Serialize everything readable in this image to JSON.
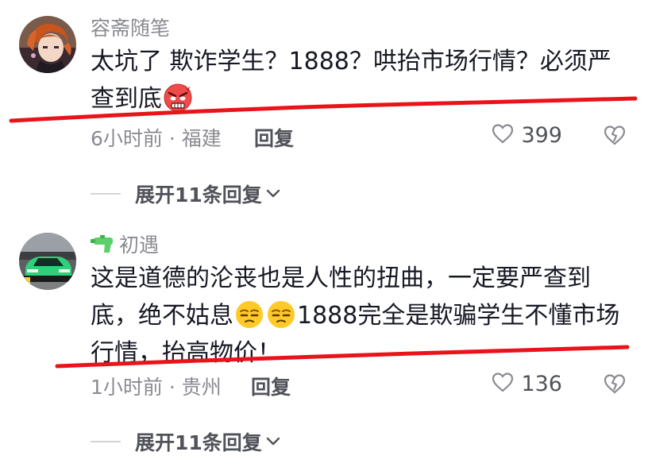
{
  "comments": [
    {
      "username": "容斋随笔",
      "content": [
        "太坑了 欺诈学生？1888？哄抬市场行情？必须严",
        "查到底"
      ],
      "time_location": "6小时前 · 福建",
      "reply_label": "回复",
      "like_count": "399",
      "expand_label": "展开11条回复",
      "emoji": "angry-face-icon",
      "avatar": "avatar-anime-character"
    },
    {
      "username": "初遇",
      "username_icon": "water-gun-icon",
      "content": [
        "这是道德的沦丧也是人性的扭曲，一定要严查到",
        "底，绝不姑息",
        "1888完全是欺骗学生不懂市场",
        "行情，抬高物价！"
      ],
      "time_location": "1小时前 · 贵州",
      "reply_label": "回复",
      "like_count": "136",
      "expand_label": "展开11条回复",
      "emoji": "unamused-face-icon",
      "avatar": "avatar-green-car"
    }
  ],
  "colors": {
    "annotation_red": "#e8141a",
    "secondary_text": "#8a8b91",
    "primary_text": "#161823"
  }
}
